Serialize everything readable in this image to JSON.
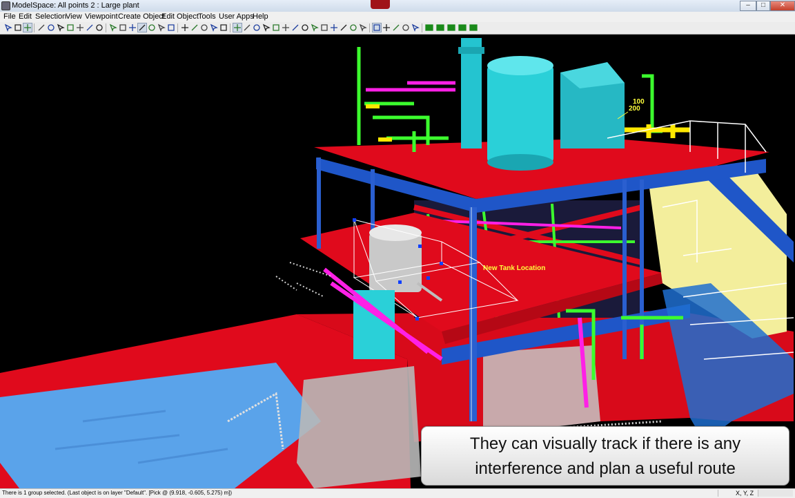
{
  "window": {
    "title": "ModelSpace: All points 2 : Large plant",
    "controls": {
      "minimize": "–",
      "maximize": "□",
      "close": "✕"
    }
  },
  "menu": {
    "items": [
      "File",
      "Edit",
      "Selection",
      "View",
      "Viewpoint",
      "Create Object",
      "Edit Object",
      "Tools",
      "User Apps",
      "Help"
    ]
  },
  "toolbar": {
    "buttons": [
      "select-arrow-icon",
      "zoom-region-icon",
      "pan-hand-icon",
      "pencil-icon",
      "move-icon",
      "orbit-icon",
      "fence-icon",
      "rectangle-icon",
      "circle-icon",
      "polygon-icon",
      "lasso-icon",
      "settings-icon",
      "sphere-icon",
      "layers-icon",
      "cut-plane-icon",
      "measure-icon",
      "dimension-icon",
      "fit-icon",
      "text-icon",
      "filter-icon",
      "snap-icon",
      "pin-icon",
      "point-icon",
      "line-icon",
      "cylinder-icon",
      "box-icon",
      "elbow-icon",
      "flange-icon",
      "valve-icon",
      "tee-icon",
      "reducer-icon",
      "steel-icon",
      "beam-icon",
      "ladder-icon",
      "rail-icon",
      "grid-icon",
      "view-top-icon",
      "view-front-icon",
      "view-side-icon",
      "render-icon",
      "print-icon",
      "display-mode-1-icon",
      "display-mode-2-icon",
      "display-mode-3-icon",
      "display-mode-4-icon",
      "display-mode-5-icon"
    ]
  },
  "viewport": {
    "labels": {
      "elevation_top": "100",
      "elevation_bottom": "200",
      "new_tank": "New Tank Location"
    },
    "colors": {
      "background": "#000000",
      "deck_red": "#e00a1c",
      "beam_blue": "#1f56c8",
      "pipe_green": "#3cff2e",
      "tank_cyan": "#2ad0d8",
      "magenta": "#ff20e6",
      "yellow_wall": "#f3ee9c",
      "new_tank_label": "#ffff3c"
    }
  },
  "caption": {
    "line1": "They can visually track if there is any",
    "line2": "interference and plan a useful route"
  },
  "status": {
    "message": "There is 1 group selected. (Last object is on layer \"Default\". [Pick @ (9.918, -0.605, 5.275) m])",
    "coords": "X, Y, Z"
  }
}
